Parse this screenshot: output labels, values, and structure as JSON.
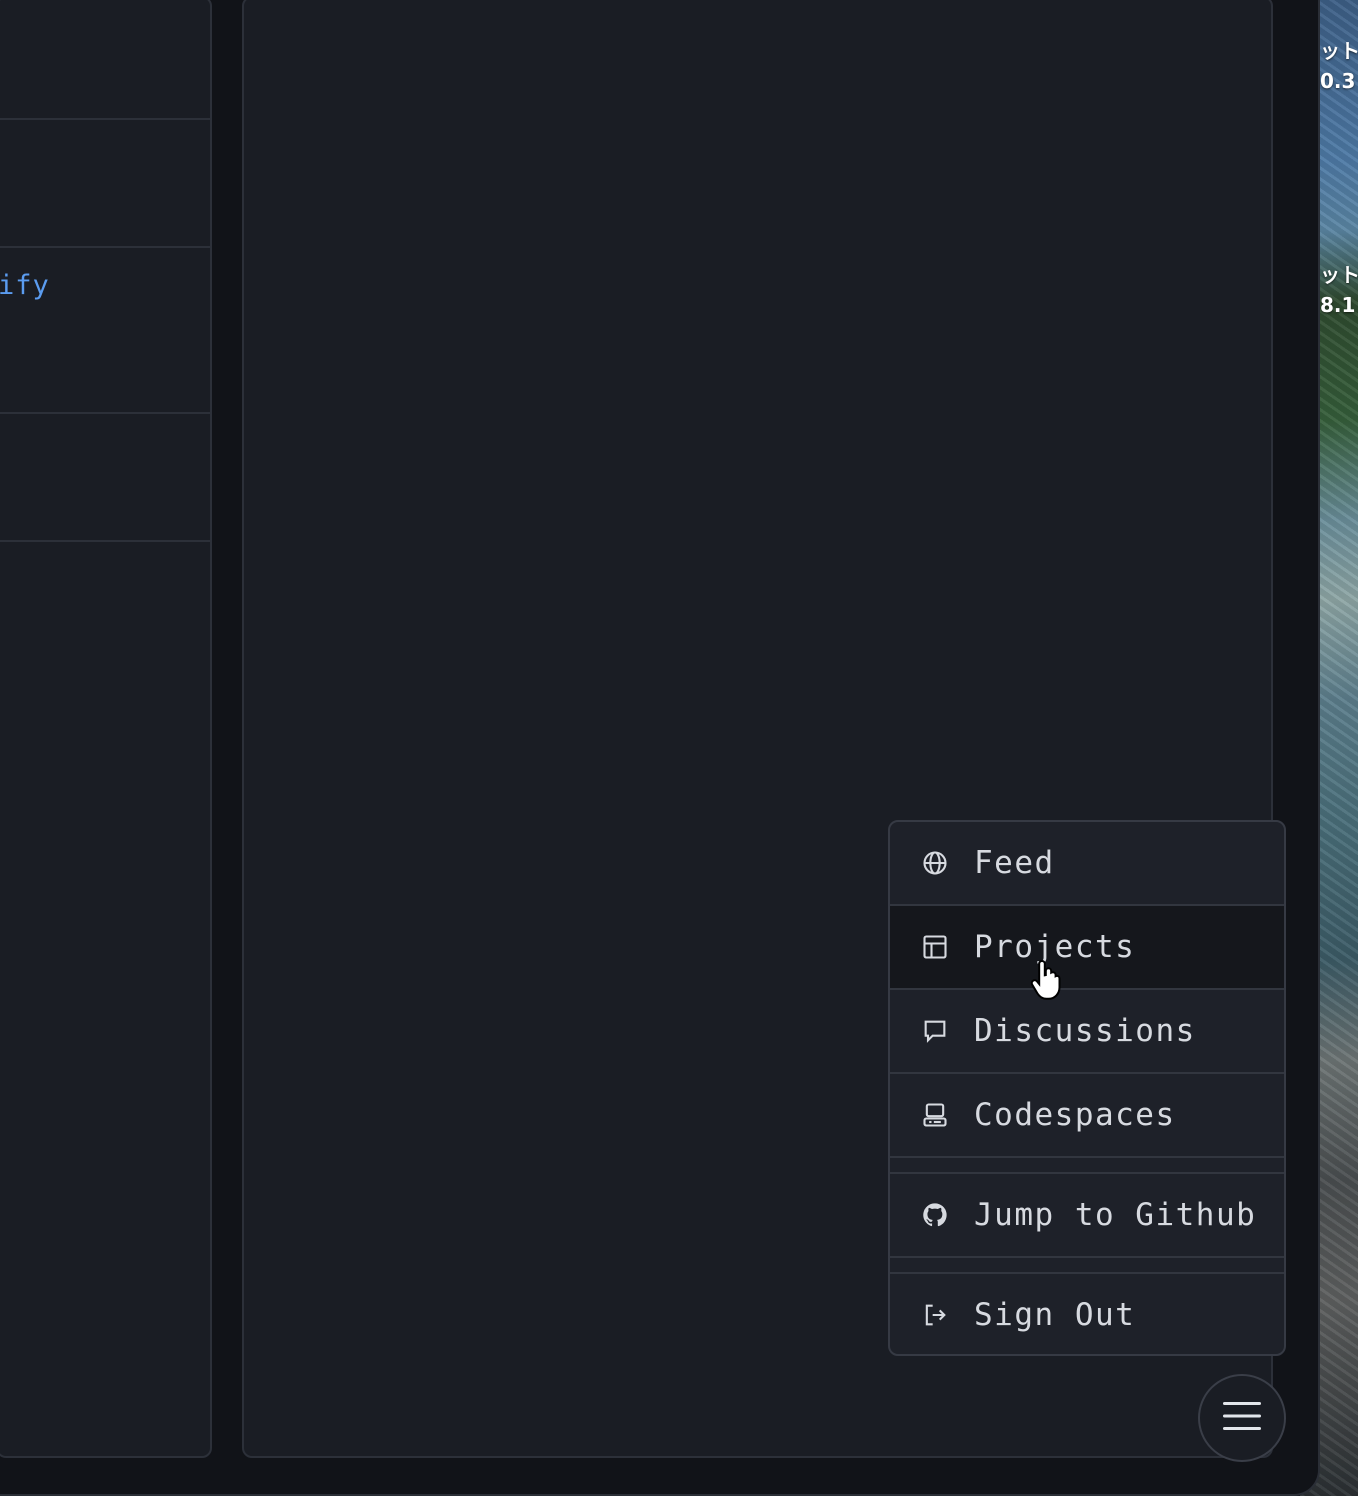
{
  "left_panel": {
    "code_snippet": "ify"
  },
  "wallpaper_labels": [
    {
      "line1": "ット",
      "line2": "0.3"
    },
    {
      "line1": "ット",
      "line2": "8.1"
    }
  ],
  "menu": {
    "items": [
      {
        "label": "Feed",
        "icon": "globe-icon"
      },
      {
        "label": "Projects",
        "icon": "table-icon",
        "active": true
      },
      {
        "label": "Discussions",
        "icon": "comment-icon"
      },
      {
        "label": "Codespaces",
        "icon": "codespaces-icon"
      },
      {
        "label": "Jump to Github",
        "icon": "github-icon"
      },
      {
        "label": "Sign Out",
        "icon": "sign-out-icon"
      }
    ]
  },
  "menu_button": {
    "icon": "hamburger-icon"
  },
  "colors": {
    "accent": "#5b9cf0",
    "panel": "#1a1d24",
    "menu_bg": "#1e2129",
    "active_item": "#15171c"
  }
}
